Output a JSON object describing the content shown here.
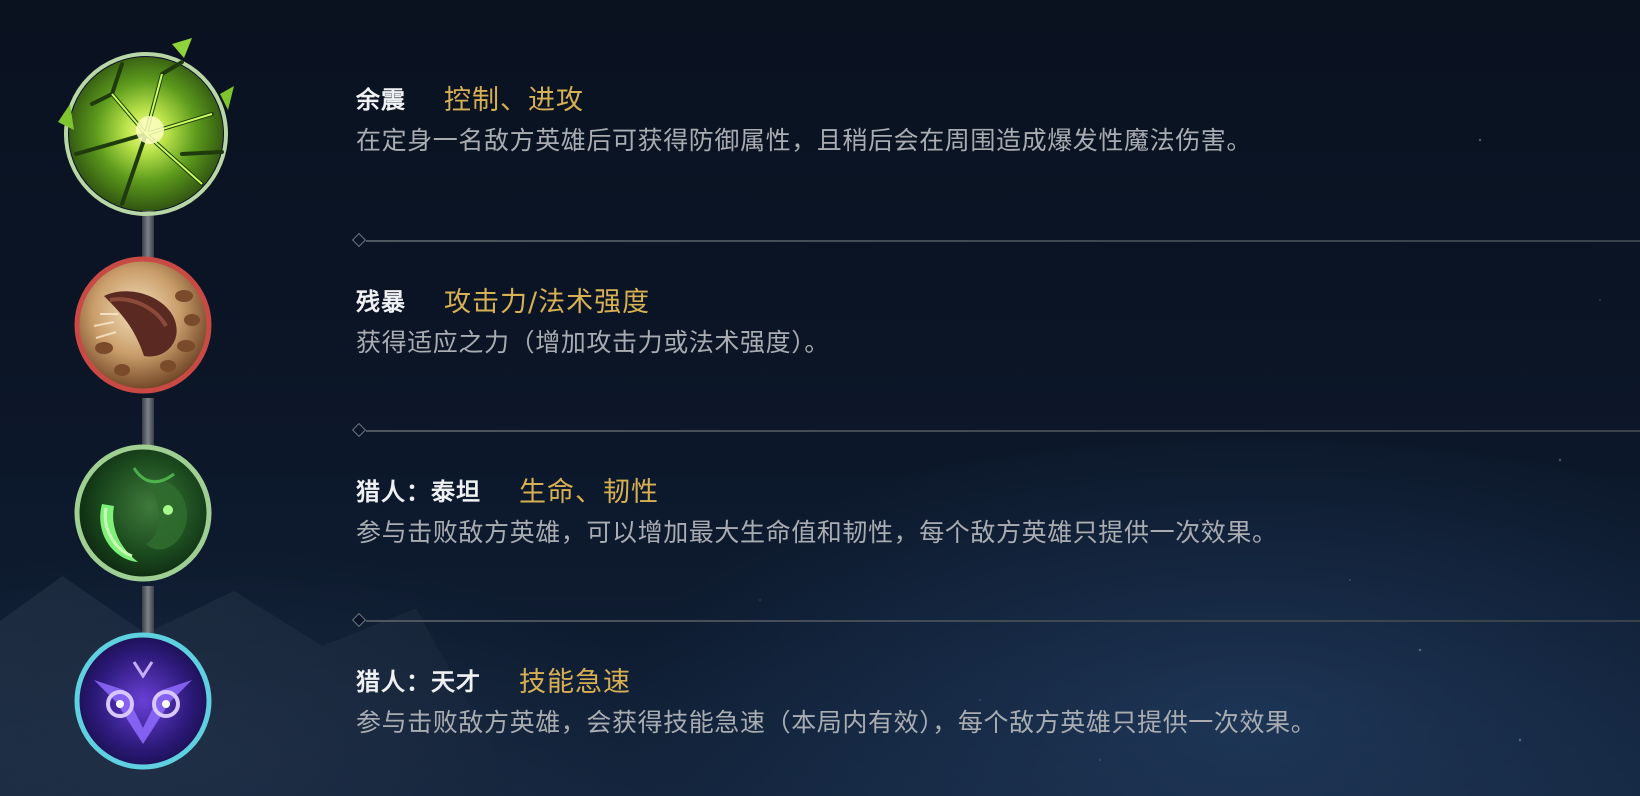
{
  "augments": [
    {
      "name": "余震",
      "tags": "控制、进攻",
      "description": "在定身一名敌方英雄后可获得防御属性，且稍后会在周围造成爆发性魔法伤害。",
      "icon": "cracked-earth-icon",
      "ring_color": "#b9d6a6"
    },
    {
      "name": "残暴",
      "tags": "攻击力/法术强度",
      "description": "获得适应之力（增加攻击力或法术强度）。",
      "icon": "brutal-claw-icon",
      "ring_color": "#c94a44"
    },
    {
      "name": "猎人：泰坦",
      "tags": "生命、韧性",
      "description": "参与击败敌方英雄，可以增加最大生命值和韧性，每个敌方英雄只提供一次效果。",
      "icon": "green-titan-icon",
      "ring_color": "#9fcf92"
    },
    {
      "name": "猎人：天才",
      "tags": "技能急速",
      "description": "参与击败敌方英雄，会获得技能急速（本局内有效），每个敌方英雄只提供一次效果。",
      "icon": "owl-eyes-icon",
      "ring_color": "#5fd0e0"
    }
  ],
  "colors": {
    "tag_gold": "#d6b053",
    "name_white": "#eef0f2",
    "description_gray": "#a9adb2"
  }
}
